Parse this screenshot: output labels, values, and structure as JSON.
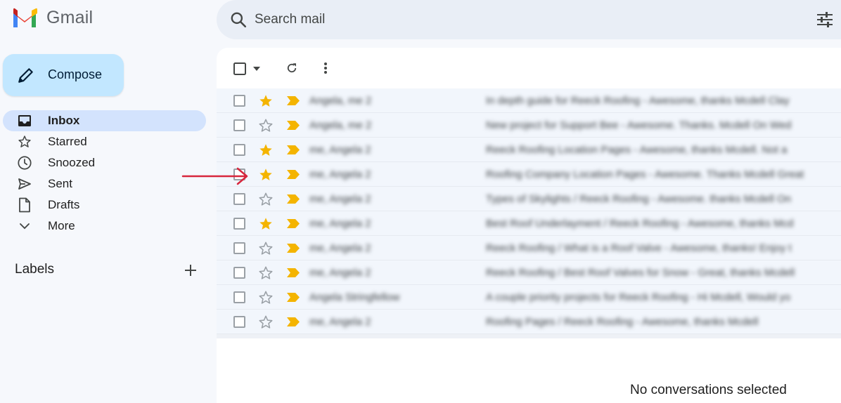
{
  "app": {
    "name": "Gmail"
  },
  "search": {
    "placeholder": "Search mail"
  },
  "compose": {
    "label": "Compose"
  },
  "sidebar": {
    "items": [
      {
        "label": "Inbox",
        "icon": "inbox-icon",
        "active": true
      },
      {
        "label": "Starred",
        "icon": "star-outline-icon"
      },
      {
        "label": "Snoozed",
        "icon": "clock-icon"
      },
      {
        "label": "Sent",
        "icon": "send-icon"
      },
      {
        "label": "Drafts",
        "icon": "draft-icon"
      },
      {
        "label": "More",
        "icon": "chevron-down-icon"
      }
    ],
    "labels_title": "Labels"
  },
  "emails": [
    {
      "starred": true,
      "sender": "Angela, me 2",
      "subject": "In depth guide for Reeck Roofing - Awesome, thanks Mcdell Clay"
    },
    {
      "starred": false,
      "sender": "Angela, me 2",
      "subject": "New project for Support Bee - Awesome. Thanks. Mcdell On Wed"
    },
    {
      "starred": true,
      "sender": "me, Angela 2",
      "subject": "Reeck Roofing Location Pages - Awesome, thanks Mcdell. Not a"
    },
    {
      "starred": true,
      "sender": "me, Angela 2",
      "subject": "Roofing Company Location Pages - Awesome. Thanks Mcdell Great"
    },
    {
      "starred": false,
      "sender": "me, Angela 2",
      "subject": "Types of Skylights / Reeck Roofing - Awesome. thanks Mcdell On"
    },
    {
      "starred": true,
      "sender": "me, Angela 2",
      "subject": "Best Roof Underlayment / Reeck Roofing - Awesome, thanks Mcd"
    },
    {
      "starred": false,
      "sender": "me, Angela 2",
      "subject": "Reeck Roofing / What is a Roof Valve - Awesome, thanks! Enjoy t"
    },
    {
      "starred": false,
      "sender": "me, Angela 2",
      "subject": "Reeck Roofing / Best Roof Valves for Snow - Great, thanks Mcdell"
    },
    {
      "starred": false,
      "sender": "Angela Stringfellow",
      "subject": "A couple priority projects for Reeck Roofing - Hi Mcdell, Would yo"
    },
    {
      "starred": false,
      "sender": "me, Angela 2",
      "subject": "Roofing Pages / Reeck Roofing - Awesome, thanks Mcdell"
    }
  ],
  "main": {
    "empty_message": "No conversations selected"
  },
  "colors": {
    "compose_bg": "#c2e7ff",
    "active_nav_bg": "#d3e3fd",
    "star_yellow": "#f4b400",
    "arrow_red": "#d7263d"
  }
}
